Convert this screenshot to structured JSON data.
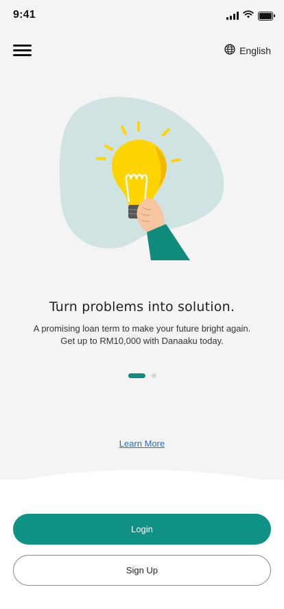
{
  "status_bar": {
    "time": "9:41",
    "icons": [
      "signal-icon",
      "wifi-icon",
      "battery-icon"
    ]
  },
  "header": {
    "menu_icon": "hamburger-menu-icon",
    "language_icon": "globe-icon",
    "language_label": "English"
  },
  "onboarding": {
    "illustration": "lightbulb-hand-illustration",
    "headline": "Turn problems into solution.",
    "description": "A promising loan term to make your future bright again. Get up to RM10,000 with Danaaku today.",
    "pagination": {
      "current": 1,
      "total": 2
    },
    "learn_more_label": "Learn More"
  },
  "actions": {
    "login_label": "Login",
    "signup_label": "Sign Up"
  },
  "colors": {
    "primary": "#0f9284",
    "background": "#f4f4f4",
    "blob": "#cfe3e2",
    "bulb": "#ffd400",
    "link": "#1a6fd0"
  }
}
